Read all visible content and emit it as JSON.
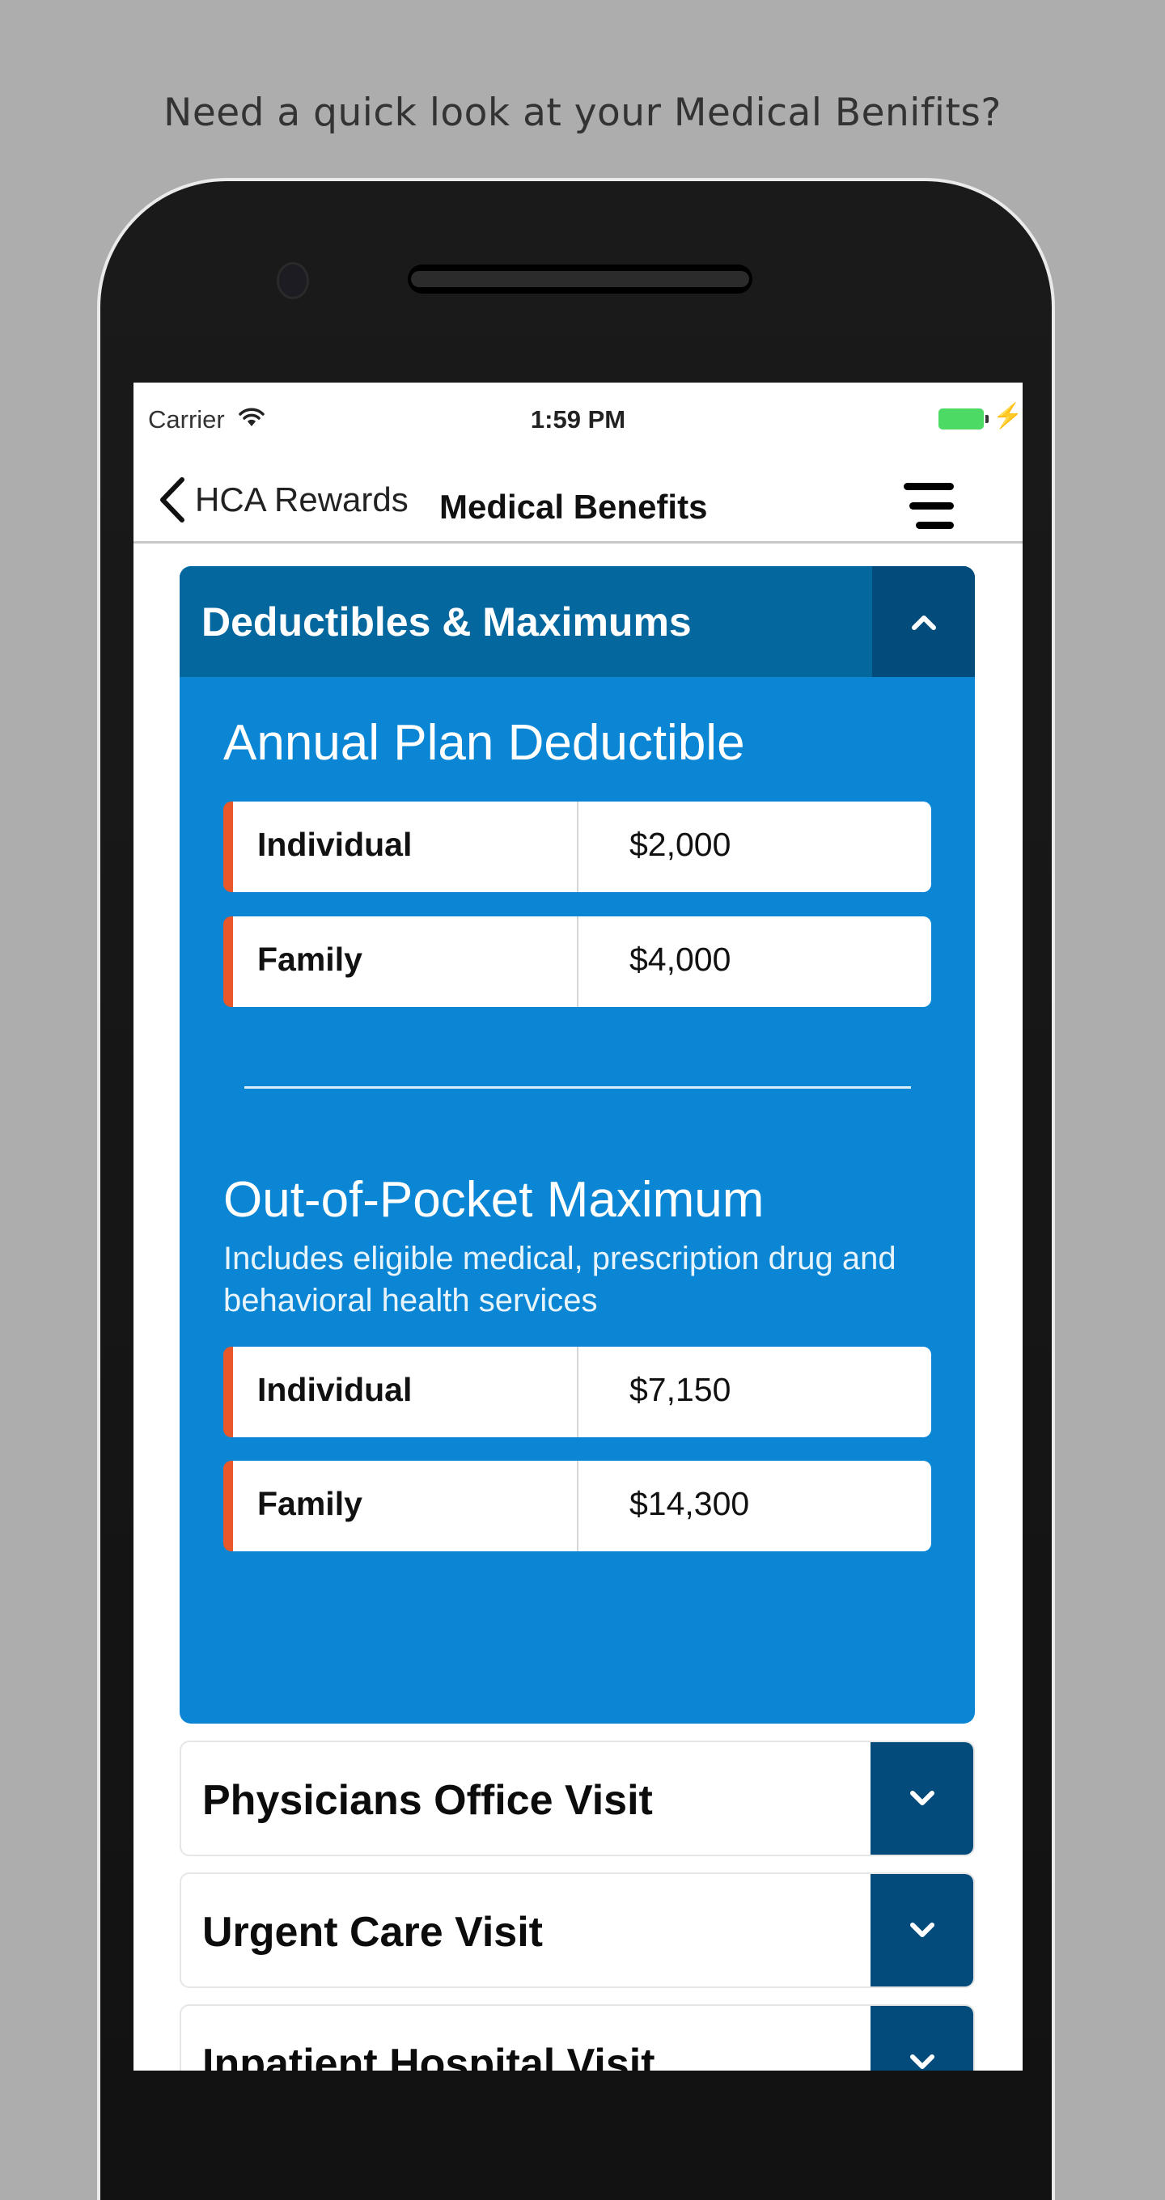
{
  "caption": "Need a quick look at your Medical Benifits?",
  "status_bar": {
    "carrier": "Carrier",
    "time": "1:59 PM",
    "icons": [
      "wifi-icon",
      "battery-icon",
      "charging-bolt-icon"
    ],
    "bolt_glyph": "⚡"
  },
  "nav": {
    "back_label": "HCA Rewards",
    "title": "Medical Benefits",
    "menu_icon": "hamburger-menu-icon"
  },
  "colors": {
    "panel_blue": "#0a86d4",
    "header_blue": "#04689f",
    "toggle_navy": "#024b7b",
    "row_accent": "#e8582a",
    "battery_green": "#4cd964"
  },
  "accordion": {
    "expanded": {
      "title": "Deductibles & Maximums",
      "toggle_icon": "chevron-up-icon",
      "sections": [
        {
          "title": "Annual Plan Deductible",
          "subtitle": "",
          "rows": [
            {
              "label": "Individual",
              "value": "$2,000"
            },
            {
              "label": "Family",
              "value": "$4,000"
            }
          ]
        },
        {
          "title": "Out-of-Pocket Maximum",
          "subtitle": "Includes eligible medical, prescription drug and behavioral health services",
          "rows": [
            {
              "label": "Individual",
              "value": "$7,150"
            },
            {
              "label": "Family",
              "value": "$14,300"
            }
          ]
        }
      ]
    },
    "collapsed": [
      {
        "title": "Physicians Office Visit",
        "toggle_icon": "chevron-down-icon"
      },
      {
        "title": "Urgent Care Visit",
        "toggle_icon": "chevron-down-icon"
      },
      {
        "title": "Inpatient Hospital Visit",
        "toggle_icon": "chevron-down-icon"
      }
    ]
  }
}
